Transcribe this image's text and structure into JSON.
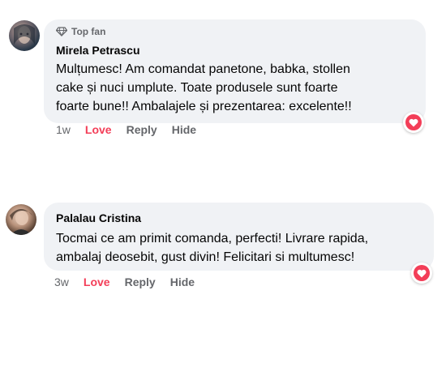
{
  "comments": [
    {
      "badge": "Top fan",
      "author": "Mirela Petrascu",
      "text": "Mulțumesc! Am comandat panetone, babka, stollen\ncake și nuci umplute. Toate produsele sunt foarte\nfoarte bune!! Ambalajele și prezentarea: excelente!!",
      "time": "1w",
      "love": "Love",
      "reply": "Reply",
      "hide": "Hide",
      "reaction": "heart-icon"
    },
    {
      "author": "Palalau Cristina",
      "text": "Tocmai ce am primit comanda, perfecti! Livrare rapida,\nambalaj deosebit, gust divin! Felicitari si multumesc!",
      "time": "3w",
      "love": "Love",
      "reply": "Reply",
      "hide": "Hide",
      "reaction": "heart-icon"
    }
  ],
  "colors": {
    "bubble": "#f0f2f5",
    "love": "#f33e58",
    "secondary_text": "#65676b"
  }
}
